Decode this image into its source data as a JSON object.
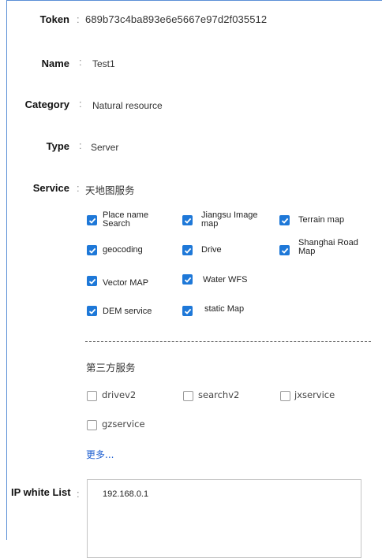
{
  "fields": {
    "token": {
      "label": "Token",
      "value": "689b73c4ba893e6e5667e97d2f035512"
    },
    "name": {
      "label": "Name",
      "value": "Test1"
    },
    "category": {
      "label": "Category",
      "value": "Natural resource"
    },
    "type": {
      "label": "Type",
      "value": "Server"
    },
    "service": {
      "label": "Service",
      "value": "天地图服务"
    },
    "ip_white_list": {
      "label": "IP white List",
      "value": "192.168.0.1"
    }
  },
  "colon": ":",
  "tianditu_services": [
    {
      "label": "Place name Search",
      "checked": true
    },
    {
      "label": "Jiangsu Image map",
      "checked": true
    },
    {
      "label": "Terrain map",
      "checked": true
    },
    {
      "label": "geocoding",
      "checked": true
    },
    {
      "label": "Drive",
      "checked": true
    },
    {
      "label": "Shanghai Road Map",
      "checked": true
    },
    {
      "label": "Vector MAP",
      "checked": true
    },
    {
      "label": "Water WFS",
      "checked": true
    },
    {
      "label": "DEM service",
      "checked": true
    },
    {
      "label": "static Map",
      "checked": true
    }
  ],
  "third_party": {
    "title": "第三方服务",
    "services": [
      {
        "label": "drivev2",
        "checked": false
      },
      {
        "label": "searchv2",
        "checked": false
      },
      {
        "label": "jxservice",
        "checked": false
      },
      {
        "label": "gzservice",
        "checked": false
      }
    ],
    "more_link": "更多..."
  },
  "colors": {
    "accent": "#1e78d8",
    "link": "#1e5fd0",
    "frame": "#5b8fd6"
  }
}
